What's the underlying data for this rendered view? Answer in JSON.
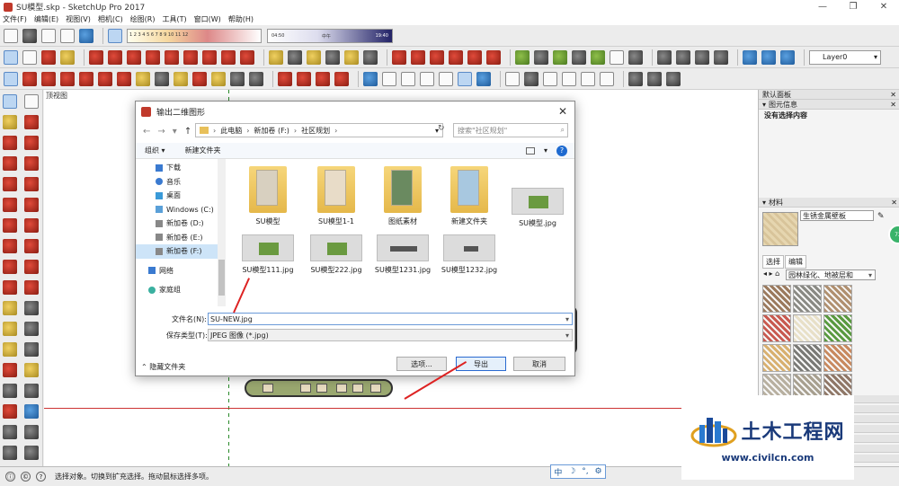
{
  "window": {
    "title": "SU模型.skp - SketchUp Pro 2017",
    "minimize": "—",
    "restore": "❐",
    "close": "✕"
  },
  "menu": [
    "文件(F)",
    "编辑(E)",
    "视图(V)",
    "相机(C)",
    "绘图(R)",
    "工具(T)",
    "窗口(W)",
    "帮助(H)"
  ],
  "toolbar": {
    "time_labels": "1 2 3 4 5 6 7 8 9 10 11 12",
    "t1": "04:50",
    "t2": "中午",
    "t3": "19:40",
    "layer": "Layer0"
  },
  "viewport": {
    "label": "顶视图"
  },
  "dialog": {
    "title": "输出二维图形",
    "crumbs": [
      "此电脑",
      "新加卷 (F:)",
      "社区规划"
    ],
    "search_placeholder": "搜索\"社区规划\"",
    "organize": "组织 ▾",
    "new_folder": "新建文件夹",
    "tree": [
      {
        "label": "下载"
      },
      {
        "label": "音乐"
      },
      {
        "label": "桌面"
      },
      {
        "label": "Windows (C:)"
      },
      {
        "label": "新加卷 (D:)"
      },
      {
        "label": "新加卷 (E:)"
      },
      {
        "label": "新加卷 (F:)"
      },
      {
        "label": "网络"
      },
      {
        "label": "家庭组"
      }
    ],
    "files": [
      {
        "name": "SU模型",
        "kind": "folder"
      },
      {
        "name": "SU模型1-1",
        "kind": "folder"
      },
      {
        "name": "图纸素材",
        "kind": "folder"
      },
      {
        "name": "新建文件夹",
        "kind": "folder"
      },
      {
        "name": "SU模型.jpg",
        "kind": "image"
      },
      {
        "name": "SU模型111.jpg",
        "kind": "image"
      },
      {
        "name": "SU模型222.jpg",
        "kind": "image"
      },
      {
        "name": "SU模型1231.jpg",
        "kind": "image"
      },
      {
        "name": "SU模型1232.jpg",
        "kind": "image"
      }
    ],
    "filename_label": "文件名(N):",
    "filename_value": "SU-NEW.jpg",
    "filetype_label": "保存类型(T):",
    "filetype_value": "JPEG 图像 (*.jpg)",
    "hide_folders": "隐藏文件夹",
    "options_btn": "选项...",
    "export_btn": "导出",
    "cancel_btn": "取消"
  },
  "rightpanel": {
    "default_tray": "默认面板",
    "entity_info": "图元信息",
    "no_selection": "没有选择内容",
    "materials": "材料",
    "material_name": "生锈金属壁板",
    "tab_select": "选择",
    "tab_edit": "编辑",
    "material_collection": "园林绿化、地被层和",
    "swatch_colors": [
      "#9b7a5e",
      "#8a8a84",
      "#b09070",
      "#c85a50",
      "#e8e0c8",
      "#5a9a40",
      "#d8b070",
      "#7a7a76",
      "#c88a60",
      "#b8b0a0",
      "#a8a090",
      "#907868"
    ]
  },
  "status": {
    "text": "选择对象。切换到扩充选择。拖动鼠标选择多项。"
  },
  "ime": [
    "中",
    "☽",
    "°,",
    "⚙"
  ],
  "badge": {
    "text": "72"
  },
  "watermark": {
    "name": "土木工程网",
    "url": "www.civilcn.com"
  }
}
